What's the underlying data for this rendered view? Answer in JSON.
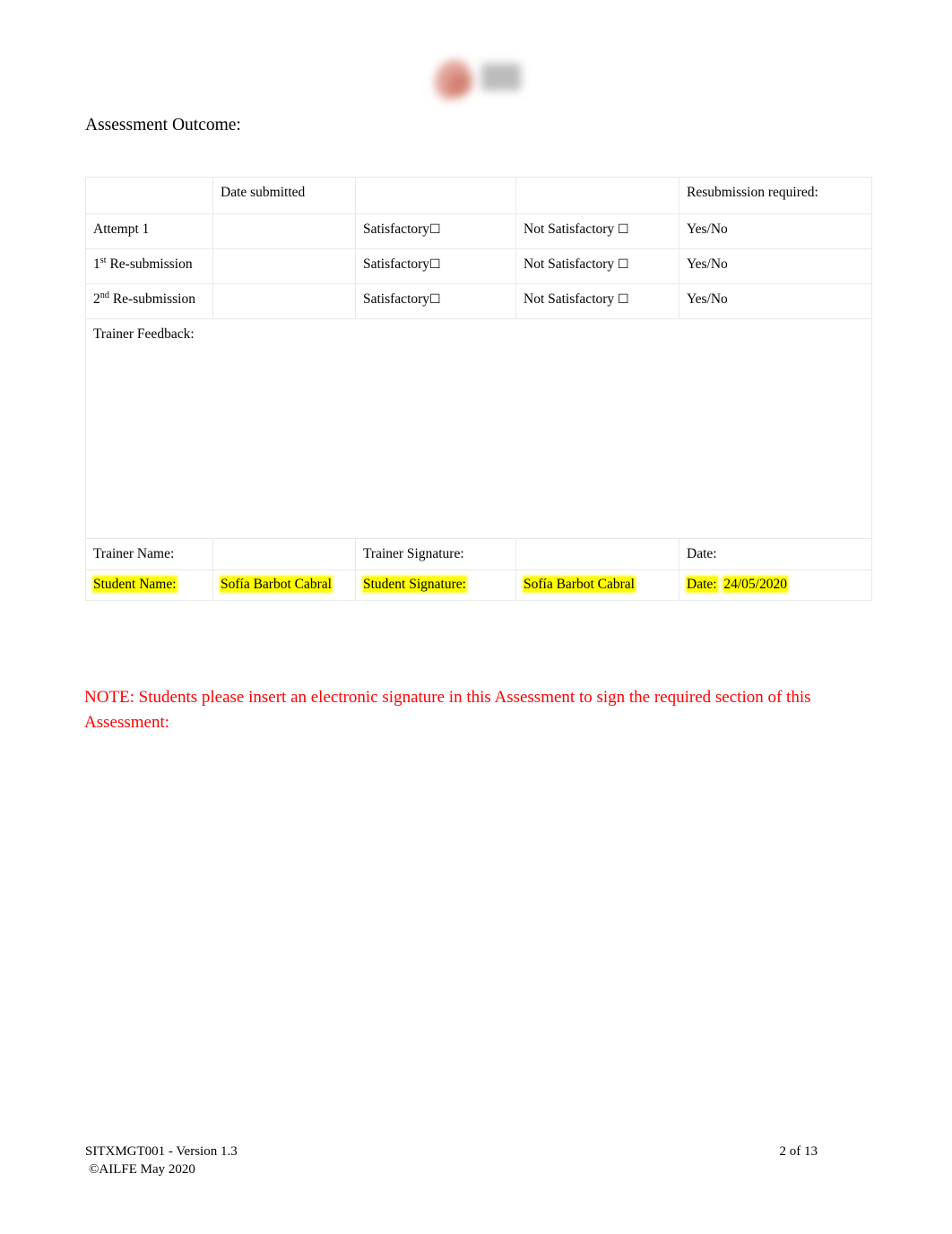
{
  "document": {
    "heading": "Assessment Outcome:",
    "logo": {
      "icon_name": "ailfe-logo",
      "mark_color": "#d1705f",
      "text_block_color": "#9a9a9a"
    }
  },
  "outcome_table": {
    "header": {
      "col1": "",
      "date_submitted": "Date submitted",
      "col3": "",
      "col4": "",
      "resubmission_required": "Resubmission required:"
    },
    "rows": [
      {
        "attempt": "Attempt 1",
        "attempt_sup": "",
        "attempt_rest": "",
        "date": "",
        "satisfactory": "Satisfactory",
        "satisfactory_box": "☐",
        "not_satisfactory": "Not Satisfactory",
        "not_satisfactory_box": "☐",
        "resubmission": "Yes/No"
      },
      {
        "attempt": "1st  Re-submission",
        "attempt_num": "1",
        "attempt_sup": "st",
        "attempt_rest": "  Re-submission",
        "date": "",
        "satisfactory": "Satisfactory",
        "satisfactory_box": "☐",
        "not_satisfactory": "Not Satisfactory",
        "not_satisfactory_box": "☐",
        "resubmission": "Yes/No"
      },
      {
        "attempt": "2nd Re-submission",
        "attempt_num": "2",
        "attempt_sup": "nd",
        "attempt_rest": " Re-submission",
        "date": "",
        "satisfactory": "Satisfactory",
        "satisfactory_box": "☐",
        "not_satisfactory": "Not Satisfactory",
        "not_satisfactory_box": "☐",
        "resubmission": "Yes/No"
      }
    ],
    "trainer_feedback_label": "Trainer Feedback:",
    "trainer_feedback_value": "",
    "trainer_row": {
      "name_label": "Trainer Name:",
      "name_value": "",
      "signature_label": "Trainer Signature:",
      "signature_value": "",
      "date_label": "Date:",
      "date_value": ""
    },
    "student_row": {
      "name_label": "Student Name:",
      "name_value": "Sofía Barbot Cabral",
      "signature_label": "Student Signature:",
      "signature_value": "Sofía Barbot Cabral",
      "date_label": "Date:",
      "date_value": "24/05/2020",
      "highlight_color": "#ffff00"
    }
  },
  "note": {
    "text": "NOTE: Students please insert an electronic signature in this Assessment to sign the required section of this Assessment:",
    "color": "#ff0000"
  },
  "footer": {
    "unit_version": "SITXMGT001 - Version 1.3",
    "copyright": "©AILFE May 2020",
    "page": "2 of 13"
  }
}
